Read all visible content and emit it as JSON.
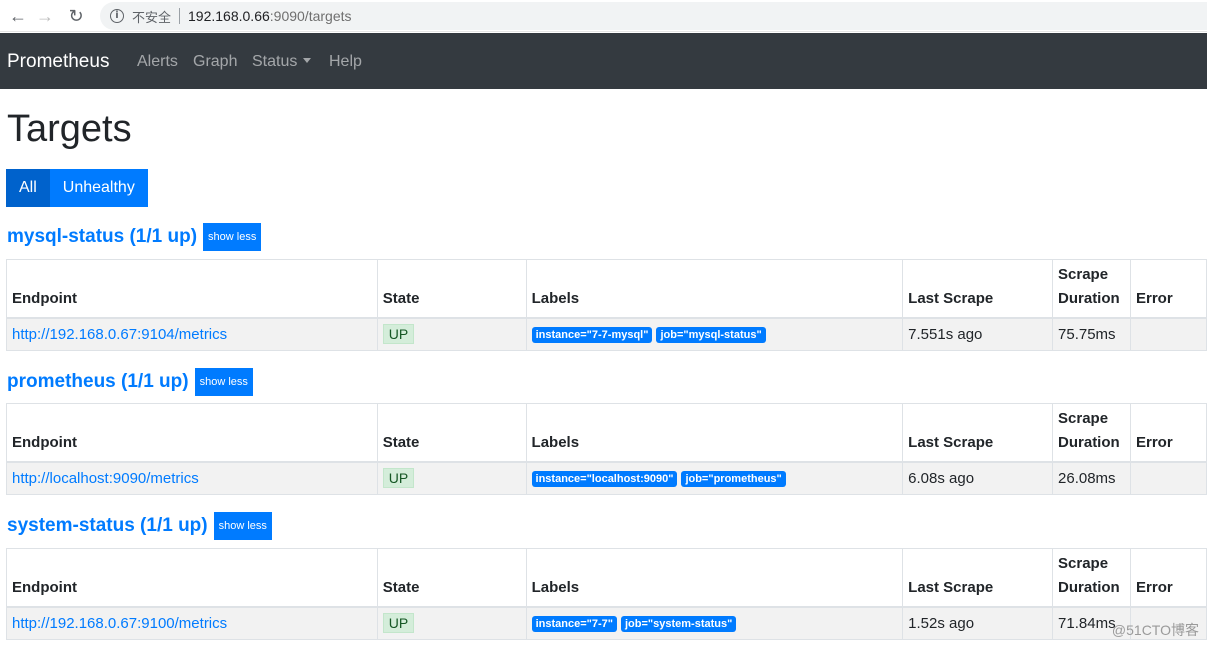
{
  "browser": {
    "insecure_label": "不安全",
    "url_host": "192.168.0.66",
    "url_rest": ":9090/targets"
  },
  "navbar": {
    "brand": "Prometheus",
    "links": [
      "Alerts",
      "Graph",
      "Status",
      "Help"
    ]
  },
  "page": {
    "title": "Targets",
    "filters": [
      "All",
      "Unhealthy"
    ],
    "active_filter": "All"
  },
  "table_headers": {
    "endpoint": "Endpoint",
    "state": "State",
    "labels": "Labels",
    "last_scrape": "Last Scrape",
    "scrape_duration_line1": "Scrape",
    "scrape_duration_line2": "Duration",
    "error": "Error"
  },
  "jobs": [
    {
      "title": "mysql-status (1/1 up)",
      "toggle": "show less",
      "rows": [
        {
          "endpoint": "http://192.168.0.67:9104/metrics",
          "state": "UP",
          "labels": [
            "instance=\"7-7-mysql\"",
            "job=\"mysql-status\""
          ],
          "last_scrape": "7.551s ago",
          "duration": "75.75ms",
          "error": ""
        }
      ]
    },
    {
      "title": "prometheus (1/1 up)",
      "toggle": "show less",
      "rows": [
        {
          "endpoint": "http://localhost:9090/metrics",
          "state": "UP",
          "labels": [
            "instance=\"localhost:9090\"",
            "job=\"prometheus\""
          ],
          "last_scrape": "6.08s ago",
          "duration": "26.08ms",
          "error": ""
        }
      ]
    },
    {
      "title": "system-status (1/1 up)",
      "toggle": "show less",
      "rows": [
        {
          "endpoint": "http://192.168.0.67:9100/metrics",
          "state": "UP",
          "labels": [
            "instance=\"7-7\"",
            "job=\"system-status\""
          ],
          "last_scrape": "1.52s ago",
          "duration": "71.84ms",
          "error": ""
        }
      ]
    }
  ],
  "watermark": "@51CTO博客",
  "colors": {
    "accent": "#007bff",
    "navbar": "#343a40",
    "up_bg": "#d4edda"
  }
}
